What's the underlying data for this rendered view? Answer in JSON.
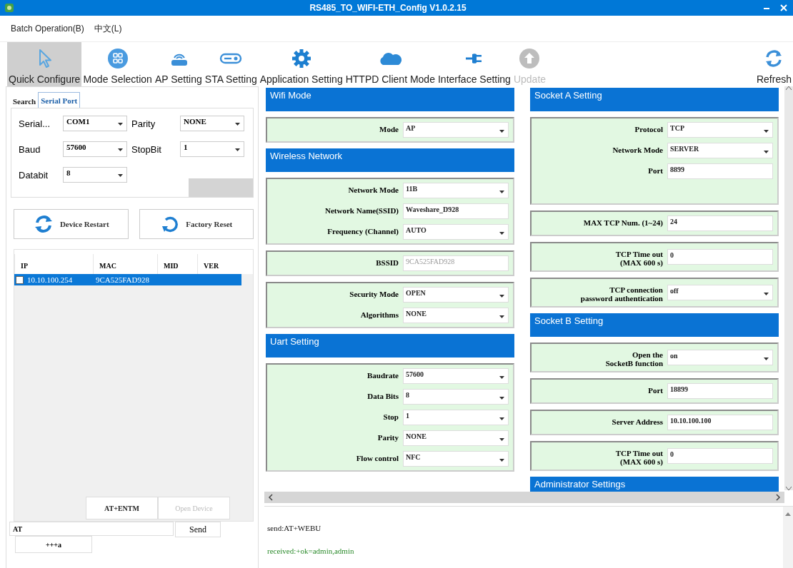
{
  "window": {
    "title": "RS485_TO_WIFI-ETH_Config V1.0.2.15"
  },
  "menu": [
    "Batch Operation(B)",
    "中文(L)"
  ],
  "toolbar": [
    {
      "label": "Quick Configure",
      "selected": true,
      "disabled": false
    },
    {
      "label": "Mode Selection",
      "selected": false,
      "disabled": false
    },
    {
      "label": "AP Setting",
      "selected": false,
      "disabled": false
    },
    {
      "label": "STA Setting",
      "selected": false,
      "disabled": false
    },
    {
      "label": "Application Setting",
      "selected": false,
      "disabled": false
    },
    {
      "label": "HTTPD Client Mode",
      "selected": false,
      "disabled": false
    },
    {
      "label": "Interface Setting",
      "selected": false,
      "disabled": false
    },
    {
      "label": "Update",
      "selected": false,
      "disabled": true
    }
  ],
  "toolbar_end": {
    "label": "Refresh"
  },
  "tabs": [
    {
      "label": "Search",
      "selected": false
    },
    {
      "label": "Serial Port",
      "selected": true
    }
  ],
  "serial_fields": [
    {
      "label": "Serial...",
      "value": "COM1"
    },
    {
      "label": "Parity",
      "value": "NONE"
    },
    {
      "label": "Baud",
      "value": "57600"
    },
    {
      "label": "StopBit",
      "value": "1"
    },
    {
      "label": "Databit",
      "value": "8"
    }
  ],
  "device_buttons": [
    "Device Restart",
    "Factory Reset"
  ],
  "device_table": {
    "columns": [
      "IP",
      "MAC",
      "MID",
      "VER"
    ],
    "rows": [
      {
        "ip": "10.10.100.254",
        "mac": "9CA525FAD928",
        "checked": false,
        "selected": true
      }
    ]
  },
  "commands": {
    "buttons": [
      {
        "label": "AT+ENTM",
        "disabled": false
      },
      {
        "label": "Open Device",
        "disabled": true
      }
    ],
    "input": "AT",
    "send": "Send",
    "extra": "+++a"
  },
  "config_columns": [
    [
      {
        "kind": "header",
        "title": "Wifi Mode"
      },
      {
        "kind": "panel",
        "rows": [
          {
            "label": "Mode",
            "value": "AP",
            "kind": "select",
            "disabled": false
          }
        ]
      },
      {
        "kind": "header",
        "title": "Wireless Network"
      },
      {
        "kind": "panel",
        "rows": [
          {
            "label": "Network Mode",
            "value": "11B",
            "kind": "select",
            "disabled": false
          },
          {
            "label": "Network Name(SSID)",
            "value": "Waveshare_D928",
            "kind": "input",
            "disabled": false
          },
          {
            "label": "Frequency (Channel)",
            "value": "AUTO",
            "kind": "select",
            "disabled": false
          }
        ]
      },
      {
        "kind": "panel",
        "rows": [
          {
            "label": "BSSID",
            "value": "9CA525FAD928",
            "kind": "input",
            "disabled": true
          }
        ]
      },
      {
        "kind": "panel",
        "rows": [
          {
            "label": "Security Mode",
            "value": "OPEN",
            "kind": "select",
            "disabled": false
          },
          {
            "label": "Algorithms",
            "value": "NONE",
            "kind": "select",
            "disabled": false
          }
        ]
      },
      {
        "kind": "header",
        "title": "Uart Setting"
      },
      {
        "kind": "panel",
        "rows": [
          {
            "label": "Baudrate",
            "value": "57600",
            "kind": "select",
            "disabled": false
          },
          {
            "label": "Data Bits",
            "value": "8",
            "kind": "select",
            "disabled": false
          },
          {
            "label": "Stop",
            "value": "1",
            "kind": "select",
            "disabled": false
          },
          {
            "label": "Parity",
            "value": "NONE",
            "kind": "select",
            "disabled": false
          },
          {
            "label": "Flow control",
            "value": "NFC",
            "kind": "select",
            "disabled": false
          }
        ]
      }
    ],
    [
      {
        "kind": "header",
        "title": "Socket A Setting"
      },
      {
        "kind": "panel",
        "rows": [
          {
            "label": "Protocol",
            "value": "TCP",
            "kind": "select",
            "disabled": false
          },
          {
            "label": "Network Mode",
            "value": "SERVER",
            "kind": "select",
            "disabled": false
          },
          {
            "label": "Port",
            "value": "8899",
            "kind": "input",
            "disabled": false
          }
        ]
      },
      {
        "kind": "panel",
        "rows": [
          {
            "label": "MAX TCP Num. (1~24)",
            "value": "24",
            "kind": "input",
            "disabled": false
          }
        ]
      },
      {
        "kind": "panel",
        "rows": [
          {
            "label": "TCP Time out\n(MAX 600 s)",
            "value": "0",
            "kind": "input",
            "disabled": false
          }
        ]
      },
      {
        "kind": "panel",
        "rows": [
          {
            "label": "TCP connection\npassword authentication",
            "value": "off",
            "kind": "select",
            "disabled": false
          }
        ]
      },
      {
        "kind": "header",
        "title": "Socket B Setting"
      },
      {
        "kind": "panel",
        "rows": [
          {
            "label": "Open the\nSocketB function",
            "value": "on",
            "kind": "select",
            "disabled": false
          }
        ]
      },
      {
        "kind": "panel",
        "rows": [
          {
            "label": "Port",
            "value": "18899",
            "kind": "input",
            "disabled": false
          }
        ]
      },
      {
        "kind": "panel",
        "rows": [
          {
            "label": "Server Address",
            "value": "10.10.100.100",
            "kind": "input",
            "disabled": false
          }
        ]
      },
      {
        "kind": "panel",
        "rows": [
          {
            "label": "TCP Time out\n(MAX 600 s)",
            "value": "0",
            "kind": "input",
            "disabled": false
          }
        ]
      },
      {
        "kind": "header",
        "title": "Administrator Settings"
      }
    ]
  ],
  "log": [
    {
      "kind": "send",
      "text": "send:AT+WEBU"
    },
    {
      "kind": "received",
      "text": "received:+ok=admin,admin"
    }
  ]
}
